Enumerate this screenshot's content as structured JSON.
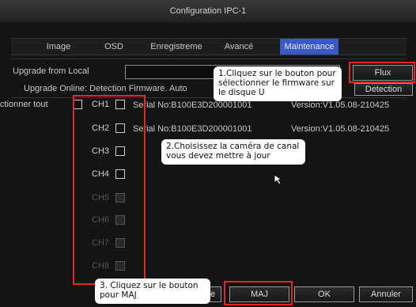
{
  "window": {
    "title": "Configuration IPC-1"
  },
  "tabs": [
    {
      "label": "Image",
      "active": false
    },
    {
      "label": "OSD",
      "active": false
    },
    {
      "label": "Enregistreme",
      "active": false
    },
    {
      "label": "Avancé",
      "active": false
    },
    {
      "label": "Maintenance",
      "active": true
    }
  ],
  "upgrade_local": {
    "label": "Upgrade from Local",
    "value": "",
    "button": "Flux"
  },
  "upgrade_online": {
    "label": "Upgrade Online: Detection Firmware. Auto",
    "button": "Detection"
  },
  "select_all": {
    "label": "ctionner tout"
  },
  "channels": [
    {
      "label": "CH1",
      "serial": "Serial No:B100E3D200001001",
      "version": "Version:V1.05.08-210425",
      "enabled": true
    },
    {
      "label": "CH2",
      "serial": "Serial No:B100E3D200001001",
      "version": "Version:V1.05.08-210425",
      "enabled": true
    },
    {
      "label": "CH3",
      "serial": "",
      "version": "",
      "enabled": true
    },
    {
      "label": "CH4",
      "serial": "",
      "version": "",
      "enabled": true
    },
    {
      "label": "CH5",
      "serial": "",
      "version": "",
      "enabled": false
    },
    {
      "label": "CH6",
      "serial": "",
      "version": "",
      "enabled": false
    },
    {
      "label": "CH7",
      "serial": "",
      "version": "",
      "enabled": false
    },
    {
      "label": "CH8",
      "serial": "",
      "version": "",
      "enabled": false
    }
  ],
  "footer": {
    "maj": "MAJ",
    "ok": "OK",
    "cancel": "Annuler",
    "hidden_left": "e"
  },
  "callouts": {
    "c1": "1.Cliquez sur le bouton pour sélectionner le firmware sur le disque U",
    "c2": "2.Choisissez la caméra de canal vous devez mettre à jour",
    "c3": "3. Cliquez sur le bouton pour MAJ"
  },
  "colors": {
    "accent": "#3b5bc4",
    "highlight": "#e8251f"
  }
}
